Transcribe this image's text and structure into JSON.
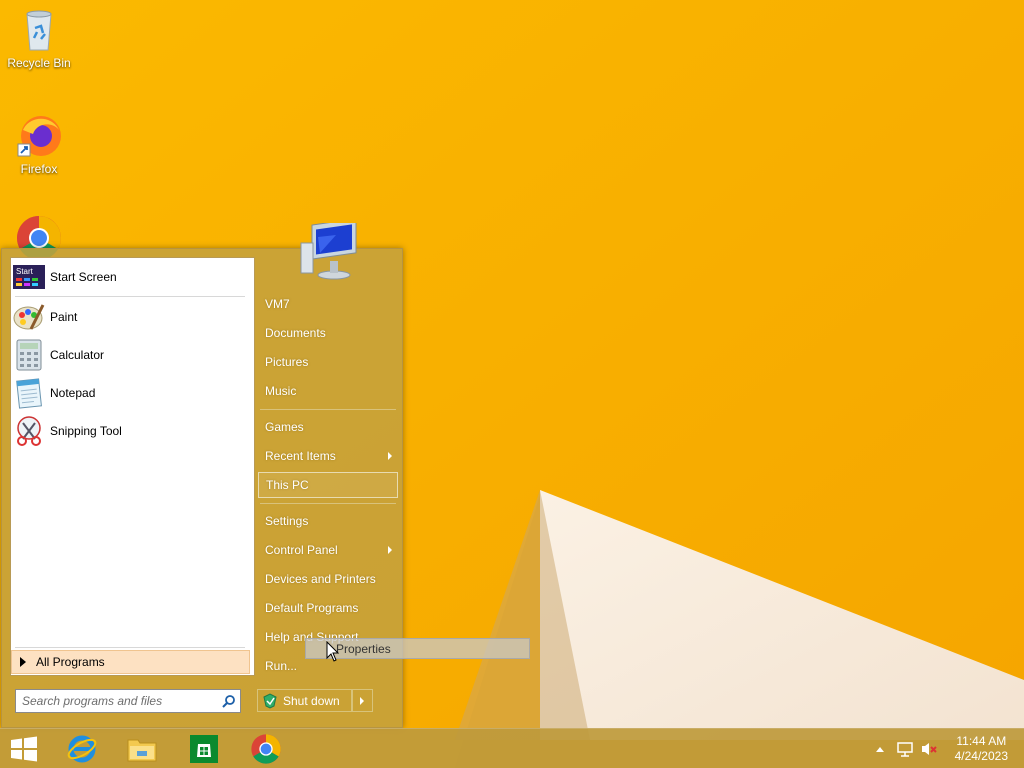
{
  "desktop": {
    "icons": [
      {
        "label": "Recycle Bin",
        "icon": "recycle-bin-icon"
      },
      {
        "label": "Firefox",
        "icon": "firefox-icon"
      },
      {
        "label": "",
        "icon": "chrome-icon"
      }
    ]
  },
  "start_menu": {
    "pinned": [
      {
        "label": "Start Screen",
        "icon": "start-screen-icon",
        "badge": "Start"
      },
      {
        "label": "Paint",
        "icon": "paint-icon"
      },
      {
        "label": "Calculator",
        "icon": "calculator-icon"
      },
      {
        "label": "Notepad",
        "icon": "notepad-icon"
      },
      {
        "label": "Snipping Tool",
        "icon": "snipping-tool-icon"
      }
    ],
    "all_programs": "All Programs",
    "search_placeholder": "Search programs and files",
    "right": {
      "user": "VM7",
      "documents": "Documents",
      "pictures": "Pictures",
      "music": "Music",
      "games": "Games",
      "recent_items": "Recent Items",
      "this_pc": "This PC",
      "settings": "Settings",
      "control_panel": "Control Panel",
      "devices_printers": "Devices and Printers",
      "default_programs": "Default Programs",
      "help_support": "Help and Support",
      "run": "Run..."
    },
    "shutdown": "Shut down"
  },
  "context_popup": {
    "label": "Properties"
  },
  "taskbar": {
    "apps": [
      "start-button",
      "internet-explorer-icon",
      "file-explorer-icon",
      "store-icon",
      "chrome-icon"
    ],
    "time": "11:44 AM",
    "date": "4/24/2023"
  },
  "colors": {
    "wallpaper": "#f8b400",
    "menu": "#c4a03c",
    "highlight": "#fde1c2"
  }
}
